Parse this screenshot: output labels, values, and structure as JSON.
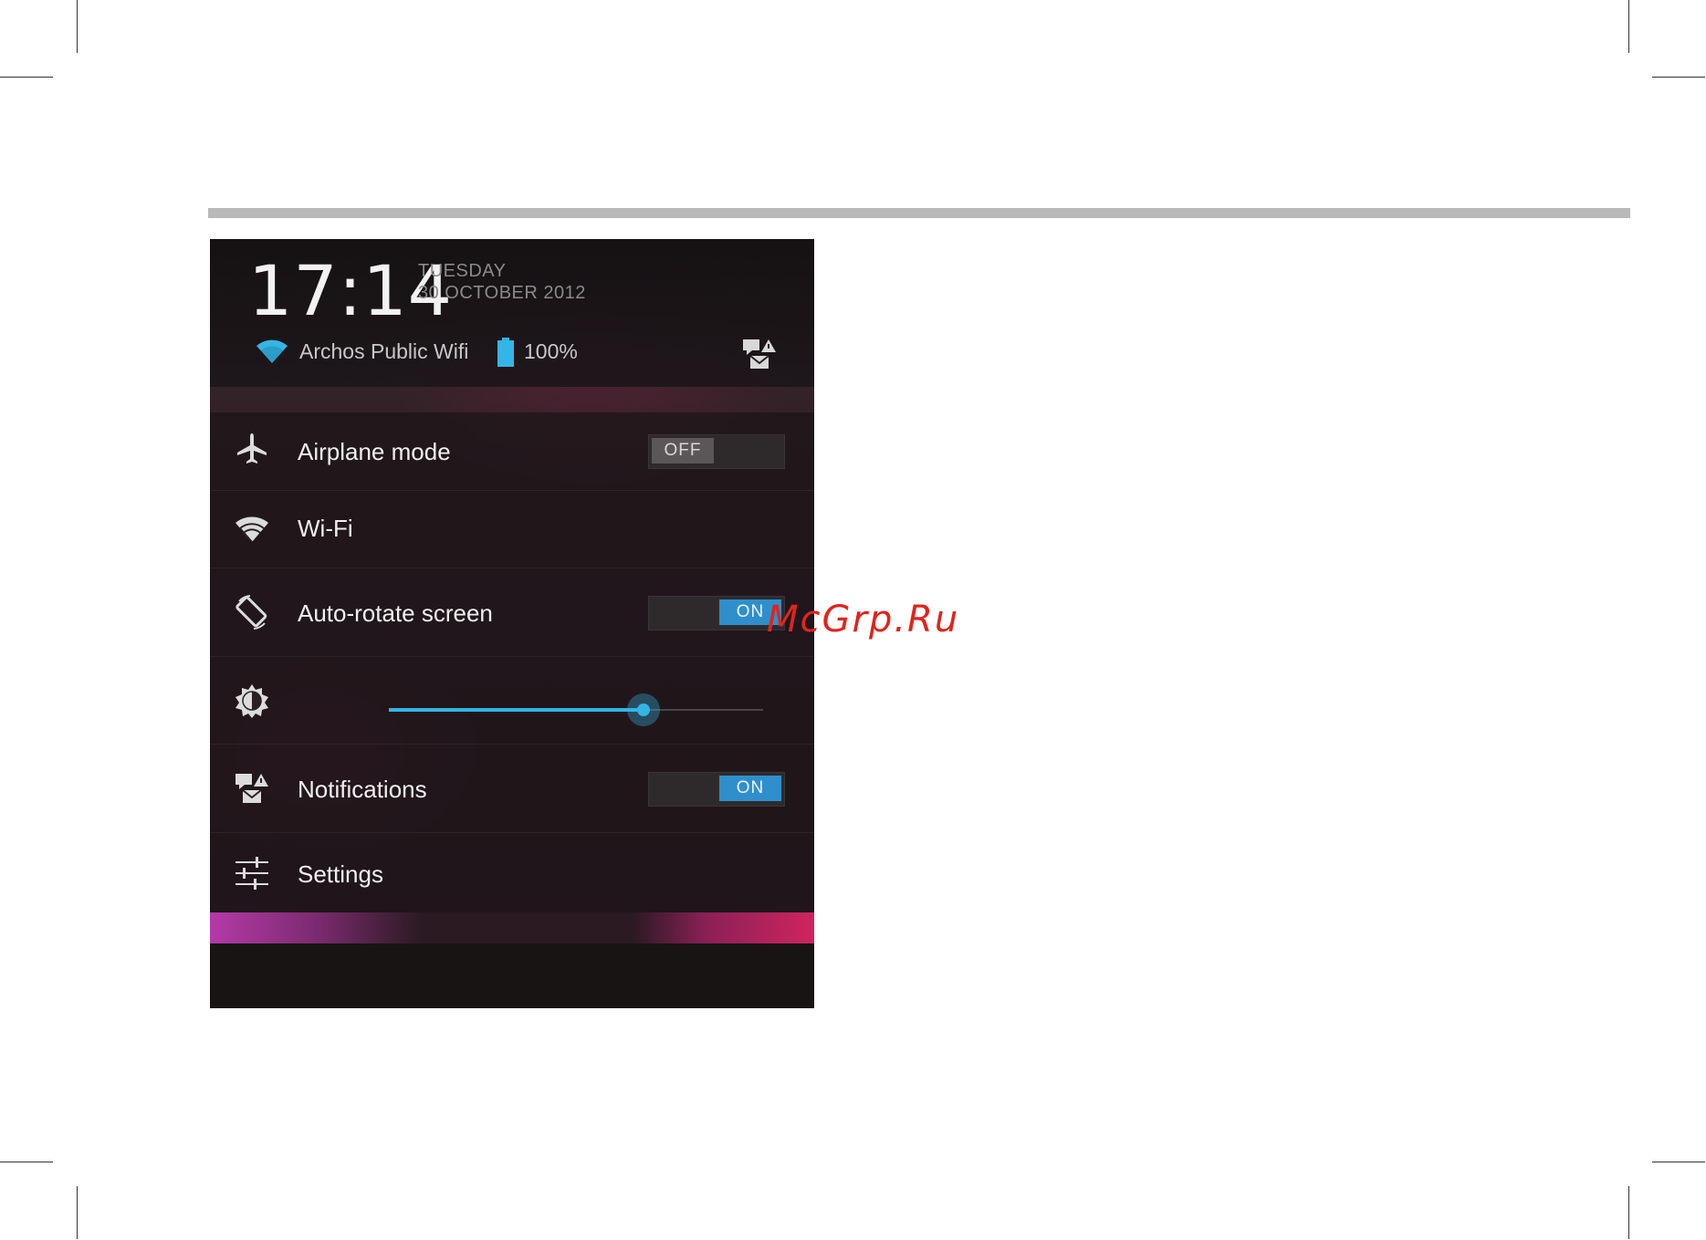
{
  "status": {
    "time": "17:14",
    "day": "TUESDAY",
    "date": "30 OCTOBER 2012",
    "network": "Archos Public Wifi",
    "battery": "100%"
  },
  "settings": {
    "airplane_mode": {
      "label": "Airplane mode",
      "toggle": "OFF"
    },
    "wifi": {
      "label": "Wi-Fi"
    },
    "auto_rotate": {
      "label": "Auto-rotate screen",
      "toggle": "ON"
    },
    "brightness": {
      "level_percent": 68
    },
    "notifications": {
      "label": "Notifications",
      "toggle": "ON"
    },
    "settings": {
      "label": "Settings"
    }
  },
  "watermark": "McGrp.Ru",
  "colors": {
    "accent": "#33b5e5",
    "toggle_on": "#2f8fcc"
  }
}
